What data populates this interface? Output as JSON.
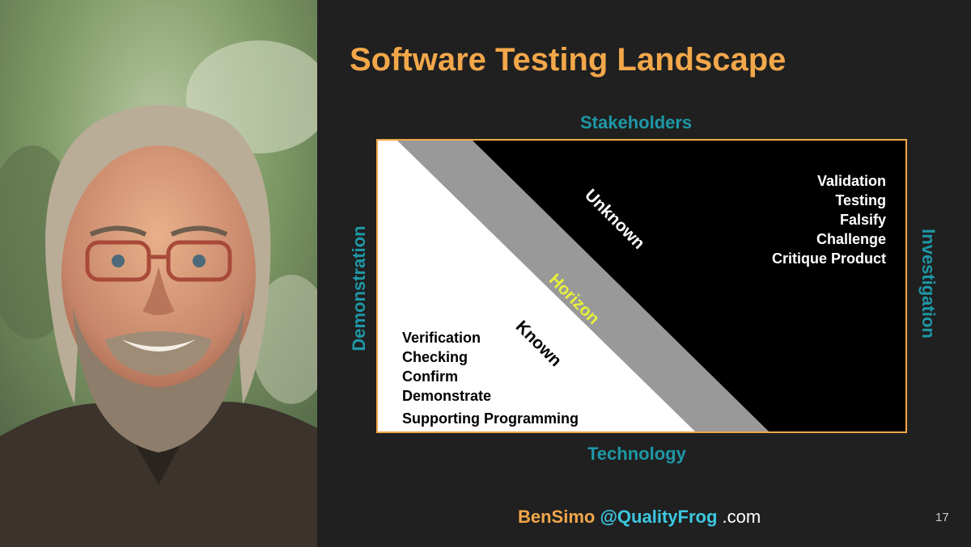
{
  "slide": {
    "title": "Software Testing Landscape",
    "page_number": "17"
  },
  "axes": {
    "top": "Stakeholders",
    "bottom": "Technology",
    "left": "Demonstration",
    "right": "Investigation"
  },
  "diagram": {
    "region_labels": {
      "unknown": "Unknown",
      "horizon": "Horizon",
      "known": "Known"
    },
    "unknown_items": [
      "Validation",
      "Testing",
      "Falsify",
      "Challenge",
      "Critique Product"
    ],
    "known_items": [
      "Verification",
      "Checking",
      "Confirm",
      "Demonstrate",
      "Supporting Programming"
    ]
  },
  "footer": {
    "name": "BenSimo",
    "handle": "@QualityFrog",
    "suffix": " .com"
  },
  "colors": {
    "title": "#F2A74A",
    "axis": "#1E98A6",
    "horizon_band": "#999999",
    "horizon_text": "#E6F03C",
    "border": "#F2A74A",
    "handle": "#3CC7E0"
  }
}
